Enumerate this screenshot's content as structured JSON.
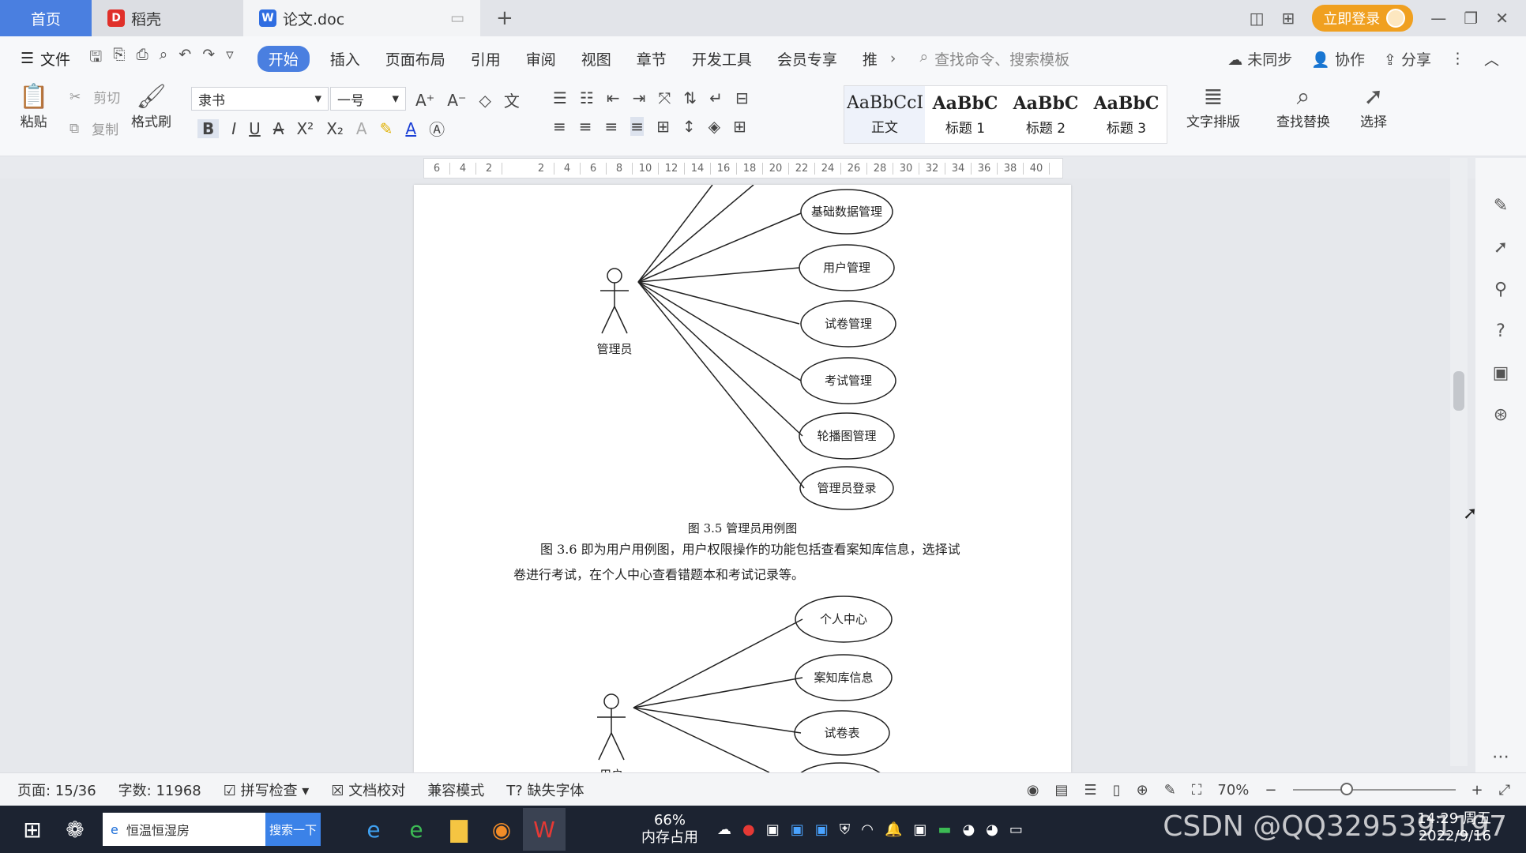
{
  "tabs": {
    "home": "首页",
    "docer": "稻壳",
    "doc": "论文.doc"
  },
  "topbar": {
    "login": "立即登录"
  },
  "menu": {
    "file": "文件",
    "items": [
      "开始",
      "插入",
      "页面布局",
      "引用",
      "审阅",
      "视图",
      "章节",
      "开发工具",
      "会员专享",
      "推"
    ],
    "search": "查找命令、搜索模板",
    "sync": "未同步",
    "collab": "协作",
    "share": "分享"
  },
  "ribbon": {
    "paste": "粘贴",
    "cut": "剪切",
    "copy": "复制",
    "format_painter": "格式刷",
    "font_name": "隶书",
    "font_size": "一号",
    "styles": [
      {
        "preview": "AaBbCcI",
        "name": "正文"
      },
      {
        "preview": "AaBbC",
        "name": "标题 1"
      },
      {
        "preview": "AaBbC",
        "name": "标题 2"
      },
      {
        "preview": "AaBbC",
        "name": "标题 3"
      }
    ],
    "text_layout": "文字排版",
    "find_replace": "查找替换",
    "select": "选择"
  },
  "ruler": [
    "6",
    "4",
    "2",
    "",
    "2",
    "4",
    "6",
    "8",
    "10",
    "12",
    "14",
    "16",
    "18",
    "20",
    "22",
    "24",
    "26",
    "28",
    "30",
    "32",
    "34",
    "36",
    "38",
    "40"
  ],
  "document": {
    "diagram1": {
      "actor": "管理员",
      "use_cases": [
        "基础数据管理",
        "用户管理",
        "试卷管理",
        "考试管理",
        "轮播图管理",
        "管理员登录"
      ]
    },
    "caption1": "图 3.5 管理员用例图",
    "paragraph_line1": "图 3.6 即为用户用例图，用户权限操作的功能包括查看案知库信息，选择试",
    "paragraph_line2": "卷进行考试，在个人中心查看错题本和考试记录等。",
    "diagram2": {
      "actor": "用户",
      "use_cases": [
        "个人中心",
        "案知库信息",
        "试卷表"
      ]
    }
  },
  "status": {
    "page": "页面: 15/36",
    "words": "字数: 11968",
    "spell": "拼写检查",
    "proof": "文档校对",
    "compat": "兼容模式",
    "missing_font": "缺失字体",
    "zoom": "70%"
  },
  "taskbar": {
    "search_text": "恒温恒湿房",
    "search_btn": "搜索一下",
    "mem_pct": "66%",
    "mem_label": "内存占用",
    "time": "14:29 周五",
    "date": "2022/9/16"
  },
  "watermark": "CSDN @QQ3295391197"
}
